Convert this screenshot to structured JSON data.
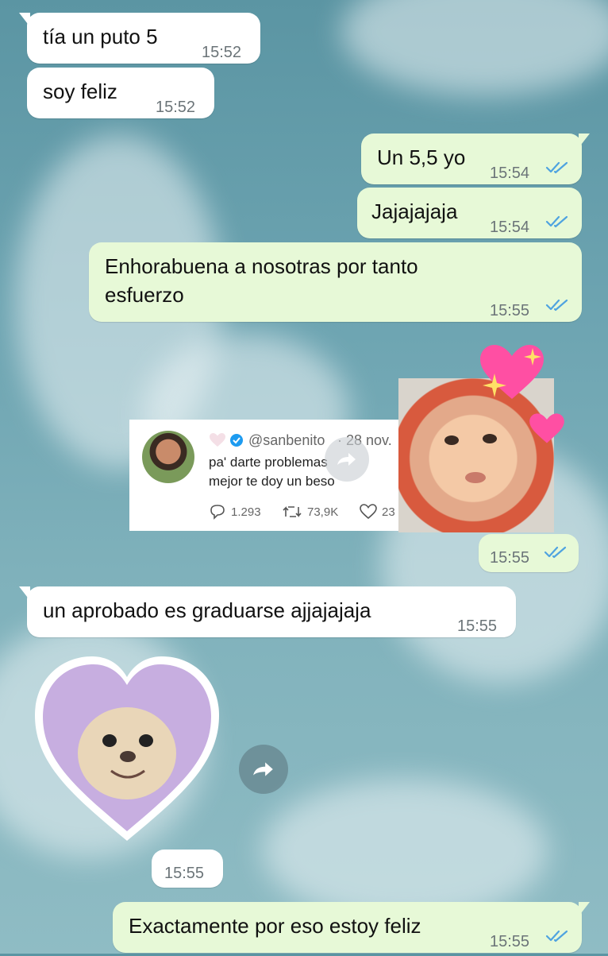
{
  "messages": [
    {
      "id": "m1",
      "text": "tía un puto 5",
      "time": "15:52"
    },
    {
      "id": "m2",
      "text": "soy feliz",
      "time": "15:52"
    },
    {
      "id": "m3",
      "text": "Un 5,5 yo",
      "time": "15:54"
    },
    {
      "id": "m4",
      "text": "Jajajajaja",
      "time": "15:54"
    },
    {
      "id": "m5",
      "line1": "Enhorabuena a nosotras por tanto",
      "line2": "esfuerzo",
      "time": "15:55"
    },
    {
      "id": "m6",
      "time": "15:55"
    },
    {
      "id": "m7",
      "text": "un aprobado es graduarse ajjajajaja",
      "time": "15:55"
    },
    {
      "id": "m8",
      "time": "15:55"
    },
    {
      "id": "m9",
      "text": "Exactamente por eso estoy feliz",
      "time": "15:55"
    }
  ],
  "tweet": {
    "handle": "@sanbenito",
    "date": "· 28 nov.",
    "line1": "pa' darte problemas",
    "line2": "mejor te doy un beso",
    "replies": "1.293",
    "retweets": "73,9K",
    "likes": "23"
  },
  "colors": {
    "incoming": "#ffffff",
    "outgoing": "#e7f9d7",
    "read_ticks": "#4fa3e0",
    "heart": "#ff4fa3"
  },
  "icons": [
    "forward-icon",
    "double-check-icon",
    "heart-icon",
    "verified-icon",
    "reply-icon",
    "retweet-icon",
    "like-icon"
  ]
}
